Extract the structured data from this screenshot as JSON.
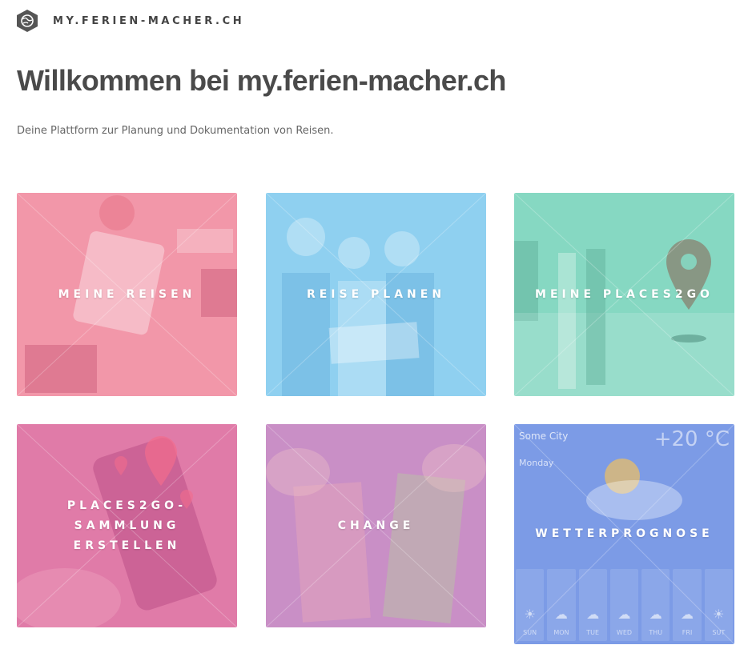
{
  "header": {
    "brand": "MY.FERIEN-MACHER.CH",
    "logo_icon": "globe-hex-icon"
  },
  "main": {
    "title": "Willkommen bei my.ferien-macher.ch",
    "subtitle": "Deine Plattform zur Planung und Dokumentation von Reisen."
  },
  "tiles": [
    {
      "label": "MEINE REISEN",
      "color": "#f297a9"
    },
    {
      "label": "REISE PLANEN",
      "color": "#8fd0f0"
    },
    {
      "label": "MEINE PLACES2GO",
      "color": "#86d8c2"
    },
    {
      "label": "PLACES2GO-SAMMLUNG ERSTELLEN",
      "color": "#e07ba8"
    },
    {
      "label": "CHANGE",
      "color": "#c98fc6"
    },
    {
      "label": "WETTERPROGNOSE",
      "color": "#7c9be6"
    }
  ],
  "weather": {
    "city": "Some City",
    "temp": "+20 °C",
    "day": "Monday",
    "days": [
      "SUN",
      "MON",
      "TUE",
      "WED",
      "THU",
      "FRI",
      "SUT"
    ]
  }
}
